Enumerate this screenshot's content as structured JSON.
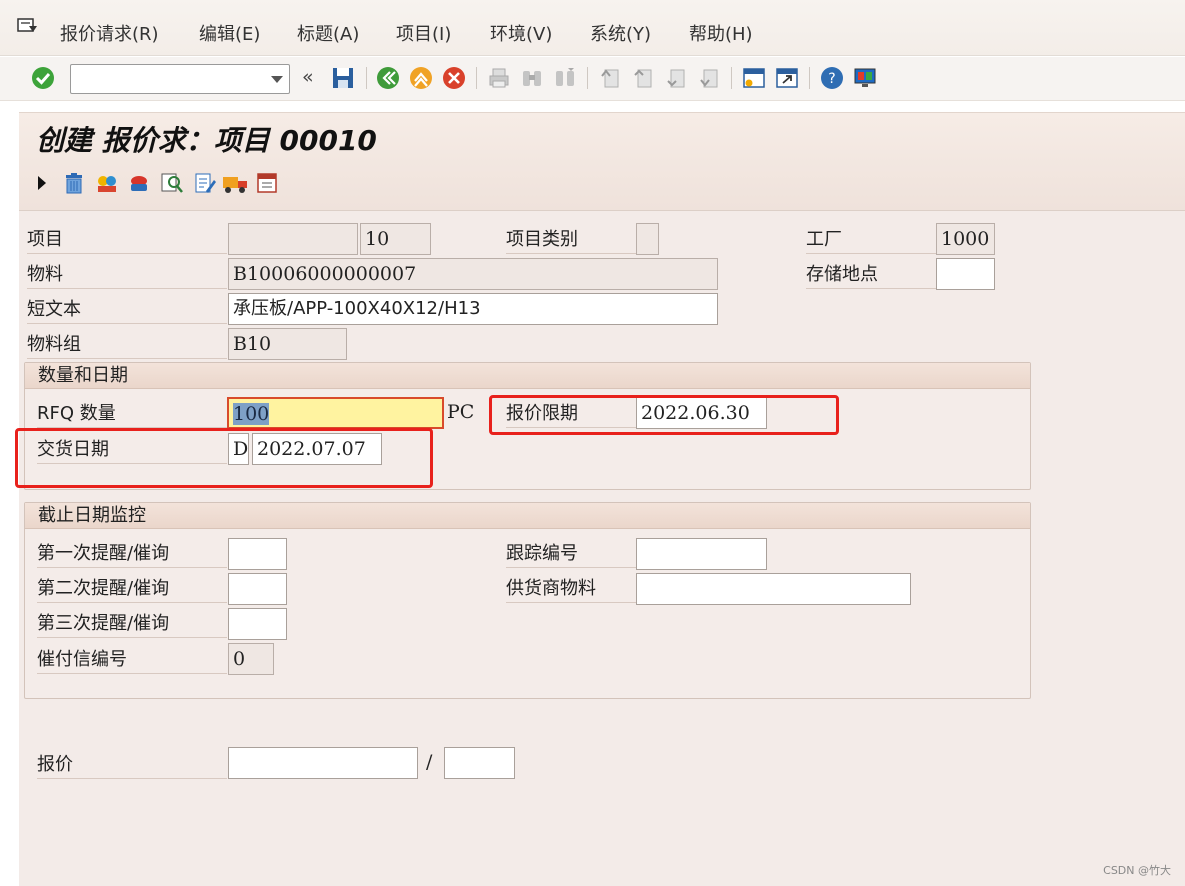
{
  "menu": {
    "items": [
      "报价请求(R)",
      "编辑(E)",
      "标题(A)",
      "项目(I)",
      "环境(V)",
      "系统(Y)",
      "帮助(H)"
    ]
  },
  "toolbar": {
    "command_value": "",
    "icons": [
      "check-icon",
      "history-back-icon",
      "save-icon",
      "back-icon",
      "exit-icon",
      "cancel-icon",
      "print-icon",
      "find-icon",
      "find-next-icon",
      "first-page-icon",
      "prev-page-icon",
      "next-page-icon",
      "last-page-icon",
      "new-session-icon",
      "shortcut-icon",
      "help-icon",
      "layout-icon"
    ]
  },
  "title": {
    "text": "创建 报价求：项目 00010",
    "icons": [
      "expand-arrow-icon",
      "delete-icon",
      "conditions-icon",
      "vendor-icon",
      "overview-icon",
      "texts-icon",
      "delivery-icon",
      "schedule-icon"
    ]
  },
  "item": {
    "label_item": "项目",
    "item_number": "10",
    "label_category": "项目类别",
    "category": "",
    "label_plant": "工厂",
    "plant": "1000",
    "label_material": "物料",
    "material": "B10006000000007",
    "label_storage": "存储地点",
    "storage": "",
    "label_short_text": "短文本",
    "short_text": "承压板/APP-100X40X12/H13",
    "label_material_group": "物料组",
    "material_group": "B10"
  },
  "qty_dates": {
    "header": "数量和日期",
    "label_rfq_qty": "RFQ 数量",
    "rfq_qty": "100",
    "unit": "PC",
    "label_quote_deadline": "报价限期",
    "quote_deadline": "2022.06.30",
    "label_delivery_date": "交货日期",
    "delivery_date_format": "D",
    "delivery_date": "2022.07.07"
  },
  "deadline_monitoring": {
    "header": "截止日期监控",
    "label_reminder1": "第一次提醒/催询",
    "reminder1": "",
    "label_reminder2": "第二次提醒/催询",
    "reminder2": "",
    "label_reminder3": "第三次提醒/催询",
    "reminder3": "",
    "label_dunning_no": "催付信编号",
    "dunning_no": "0",
    "label_tracking_no": "跟踪编号",
    "tracking_no": "",
    "label_vendor_material": "供货商物料",
    "vendor_material": ""
  },
  "quotation": {
    "label": "报价",
    "value": "",
    "separator": "/",
    "value2": ""
  },
  "watermark": "CSDN @竹大",
  "colors": {
    "highlight_red": "#e8211c",
    "input_yellow": "#fff3a0",
    "panel_bg": "#f3ebe8"
  }
}
